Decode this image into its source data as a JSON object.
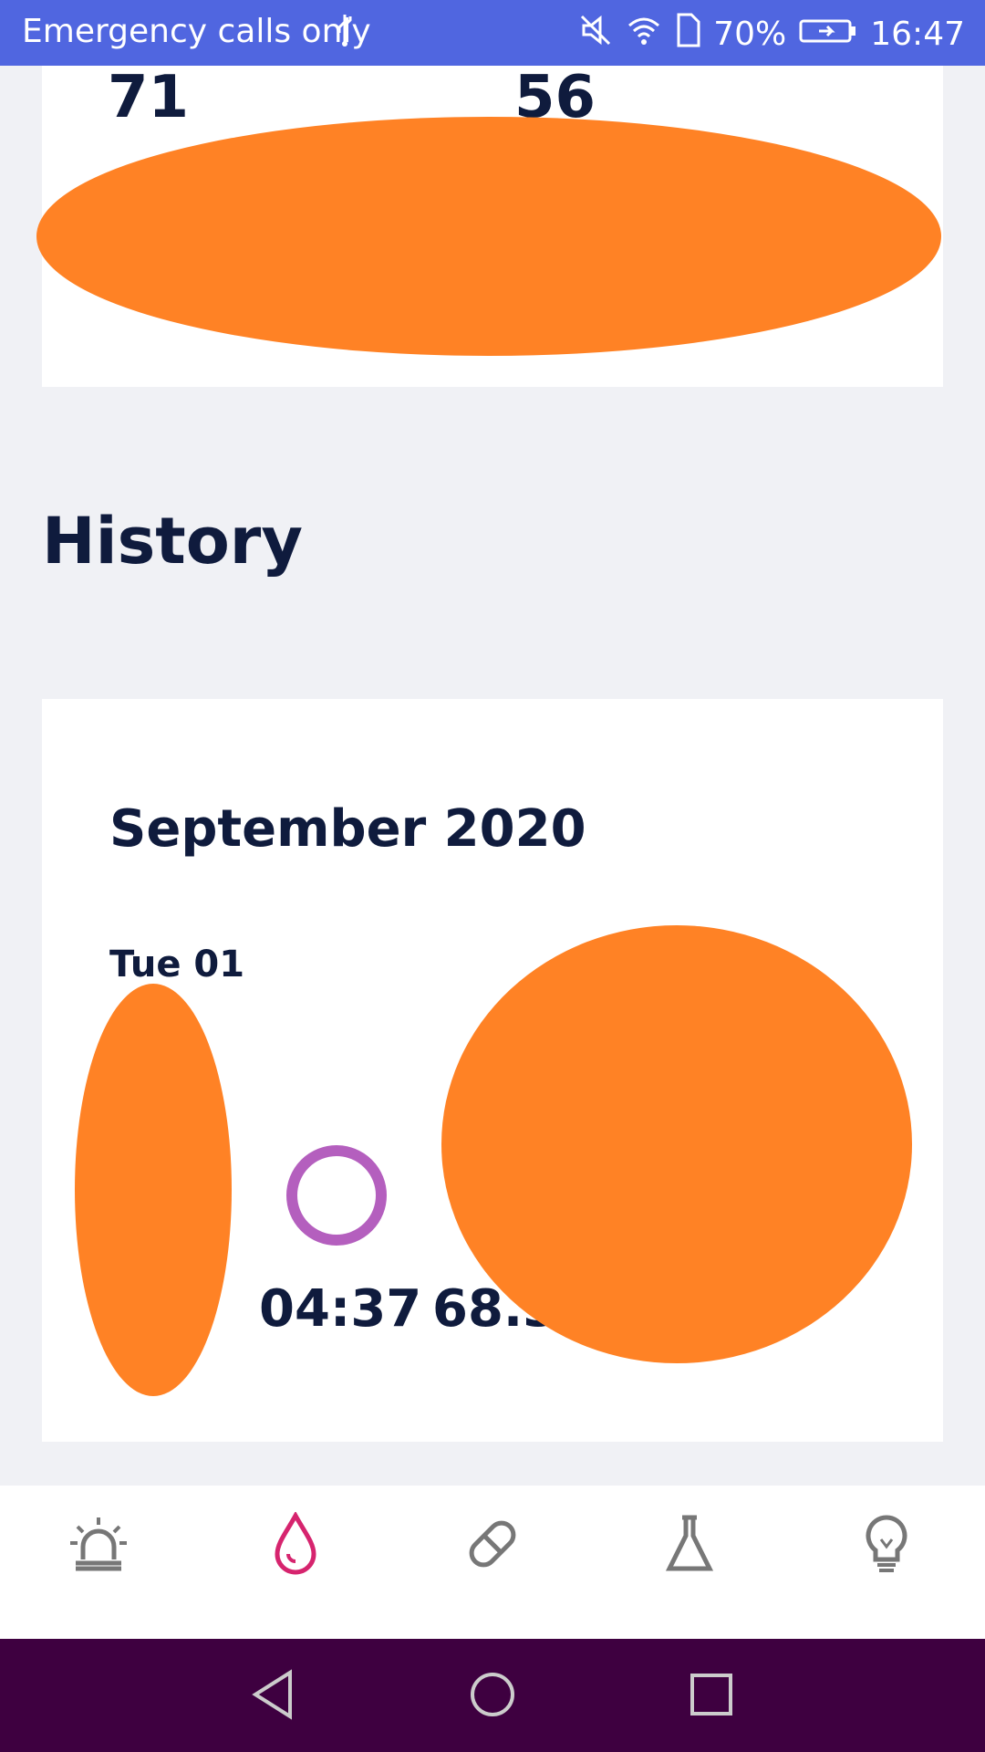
{
  "status_bar": {
    "left_text": "Emergency calls only",
    "battery": "70%",
    "time": "16:47"
  },
  "top_card": {
    "value_left": "71",
    "value_right": "56"
  },
  "history": {
    "title": "History",
    "month": "September 2020",
    "day": "Tue 01",
    "time_value": "04:37",
    "weight_value": "68.3"
  },
  "tabs": [
    {
      "name": "alert-icon"
    },
    {
      "name": "blood-drop-icon"
    },
    {
      "name": "pill-icon"
    },
    {
      "name": "flask-icon"
    },
    {
      "name": "bulb-icon"
    }
  ],
  "colors": {
    "accent": "#5066E0",
    "orange": "#FF8225",
    "ring": "#B45FBE",
    "drop": "#D6246E",
    "nav": "#3E0040"
  }
}
